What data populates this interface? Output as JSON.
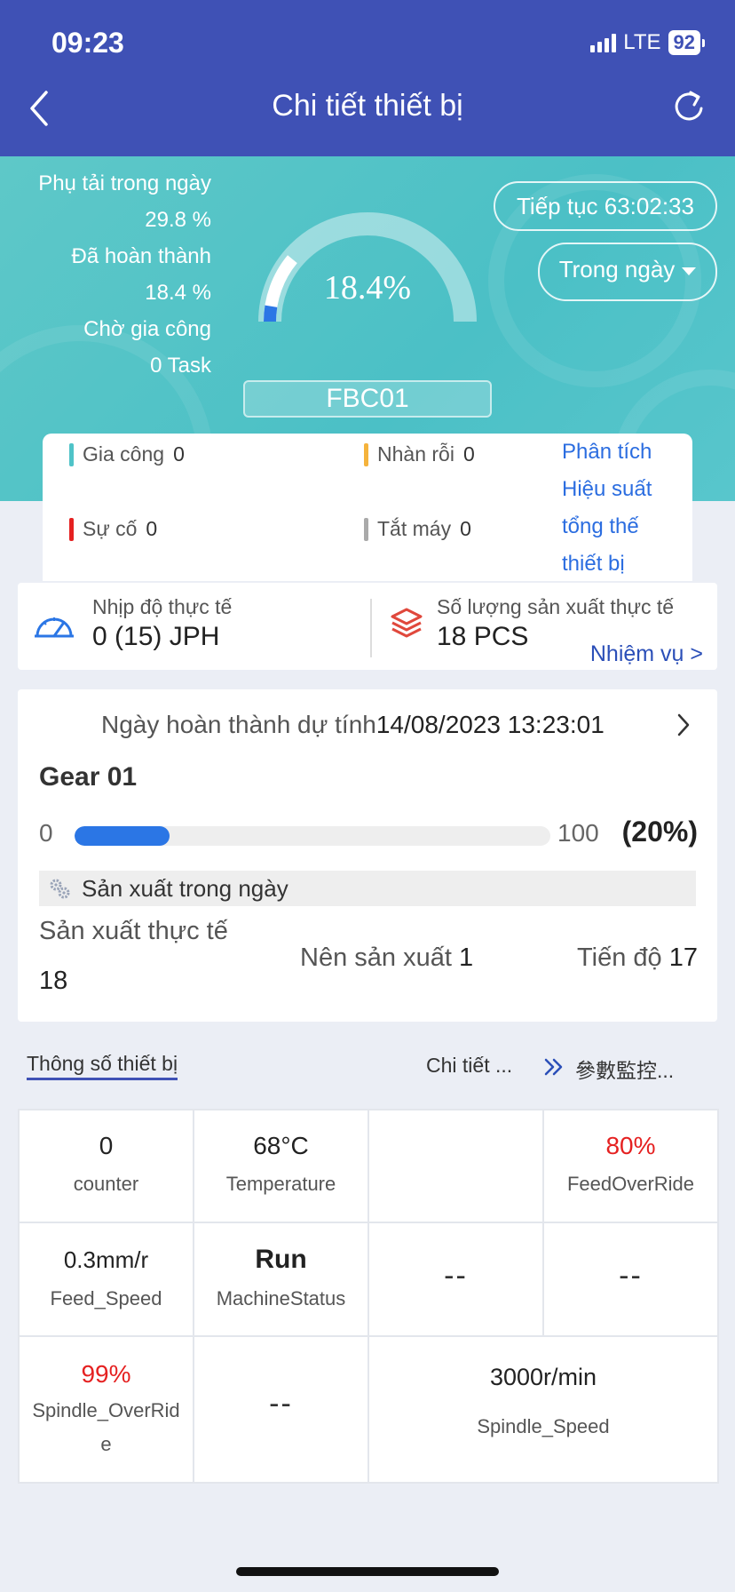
{
  "status_bar": {
    "time": "09:23",
    "network": "LTE",
    "battery": "92"
  },
  "nav": {
    "title": "Chi tiết thiết bị"
  },
  "summary": {
    "load_label": "Phụ tải trong ngày",
    "load_value": "29.8 %",
    "done_label": "Đã hoàn thành",
    "done_value": "18.4 %",
    "pending_label": "Chờ gia công",
    "pending_value": "0 Task",
    "gauge_value": "18.4%",
    "gauge_fraction": 0.184,
    "machine_id": "FBC01",
    "timer": "Tiếp tục 63:02:33",
    "range": "Trong ngày"
  },
  "states": {
    "processing": {
      "label": "Gia công",
      "count": "0",
      "color": "#4fc3c8"
    },
    "idle": {
      "label": "Nhàn rỗi",
      "count": "0",
      "color": "#f5b33c"
    },
    "fault": {
      "label": "Sự cố",
      "count": "0",
      "color": "#e52121"
    },
    "off": {
      "label": "Tắt máy",
      "count": "0",
      "color": "#aaaaaa"
    },
    "analysis_link": [
      "Phân tích",
      "Hiệu suất",
      "tổng thế",
      "thiết bị"
    ]
  },
  "metrics": {
    "rate_label": "Nhịp độ thực tế",
    "rate_value": "0 (15) JPH",
    "qty_label": "Số lượng sản xuất thực tế",
    "qty_value": "18 PCS",
    "task_link": "Nhiệm vụ >"
  },
  "task": {
    "eta_label": "Ngày hoàn thành dự tính",
    "eta_value": "14/08/2023 13:23:01",
    "name": "Gear 01",
    "min": "0",
    "max": "100",
    "percent_text": "(20%)",
    "progress_fraction": 0.2,
    "day_section": "Sản xuất trong ngày",
    "actual_label": "Sản xuất thực tế",
    "actual_value": "18",
    "should_label": "Nên sản xuất",
    "should_value": "1",
    "progress_label": "Tiến độ",
    "progress_value": "17"
  },
  "params_header": {
    "tab": "Thông số thiết bị",
    "detail_link": "Chi tiết ...",
    "monitor_link": "參數監控..."
  },
  "params": {
    "counter": {
      "value": "0",
      "label": "counter"
    },
    "temperature": {
      "value": "68°C",
      "label": "Temperature"
    },
    "feed_override": {
      "value": "80%",
      "label": "FeedOverRide"
    },
    "feed_speed": {
      "value": "0.3mm/r",
      "label": "Feed_Speed"
    },
    "machine_status": {
      "value": "Run",
      "label": "MachineStatus"
    },
    "empty_a": "--",
    "empty_b": "--",
    "spindle_override": {
      "value": "99%",
      "label": "Spindle_OverRid",
      "label_wrap": "e"
    },
    "empty_c": "--",
    "spindle_speed": {
      "value": "3000r/min",
      "label": "Spindle_Speed"
    }
  },
  "colors": {
    "header": "#3f51b5",
    "hero": "#4bc0c6",
    "accent_blue": "#2b76e5",
    "alert_red": "#e52121"
  }
}
